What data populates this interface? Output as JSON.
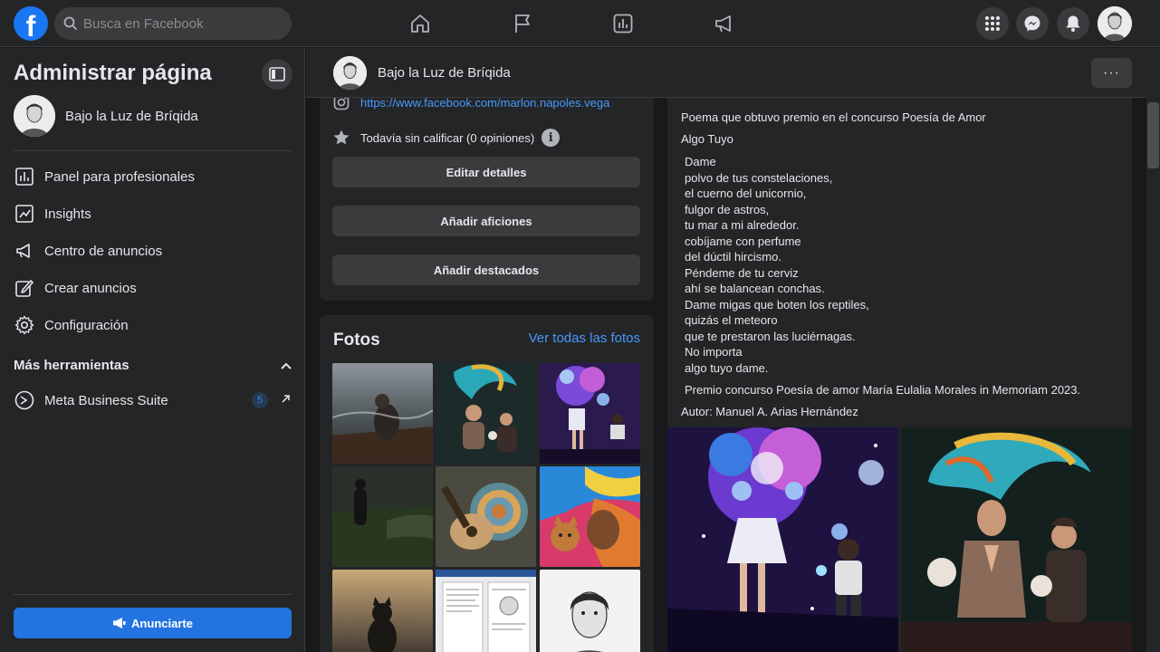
{
  "topbar": {
    "logo": "f",
    "search_placeholder": "Busca en Facebook",
    "nav_icons": [
      "home-icon",
      "flag-icon",
      "insights-icon",
      "megaphone-icon"
    ],
    "right_icons": [
      "menu-grid-icon",
      "messenger-icon",
      "bell-icon"
    ]
  },
  "sidebar": {
    "title": "Administrar página",
    "page_name": "Bajo la Luz de Bríqida",
    "items": [
      {
        "label": "Panel para profesionales",
        "icon": "dashboard-icon"
      },
      {
        "label": "Insights",
        "icon": "insights-icon"
      },
      {
        "label": "Centro de anuncios",
        "icon": "megaphone-icon"
      },
      {
        "label": "Crear anuncios",
        "icon": "pencil-icon"
      },
      {
        "label": "Configuración",
        "icon": "gear-icon"
      }
    ],
    "section_title": "Más herramientas",
    "tools": [
      {
        "label": "Meta Business Suite",
        "badge": "5"
      }
    ],
    "cta_label": "Anunciarte"
  },
  "page_header": {
    "name": "Bajo la Luz de Bríqida",
    "more_label": "···"
  },
  "intro": {
    "url": "https://www.facebook.com/marlon.napoles.vega",
    "rating": "Todavía sin calificar (0 opiniones)",
    "buttons": [
      "Editar detalles",
      "Añadir aficiones",
      "Añadir destacados"
    ]
  },
  "photos": {
    "title": "Fotos",
    "see_all": "Ver todas las fotos"
  },
  "post": {
    "line1": "Poema que obtuvo premio en el concurso Poesía de Amor",
    "poem_title": "Algo Tuyo",
    "poem_lines": [
      "Dame",
      "polvo de tus constelaciones,",
      "el cuerno del unicornio,",
      "fulgor de astros,",
      "tu mar a mi alrededor.",
      "cobíjame con perfume",
      "del dúctil hircismo.",
      "Péndeme de tu cerviz",
      "ahí se balancean conchas.",
      "Dame migas que boten los reptiles,",
      "quizás el meteoro",
      "que te prestaron las luciérnagas.",
      "No importa",
      "algo tuyo dame."
    ],
    "prize": "Premio concurso Poesía de amor María Eulalia Morales in Memoriam 2023.",
    "author": "Autor: Manuel A. Arias Hernández"
  }
}
